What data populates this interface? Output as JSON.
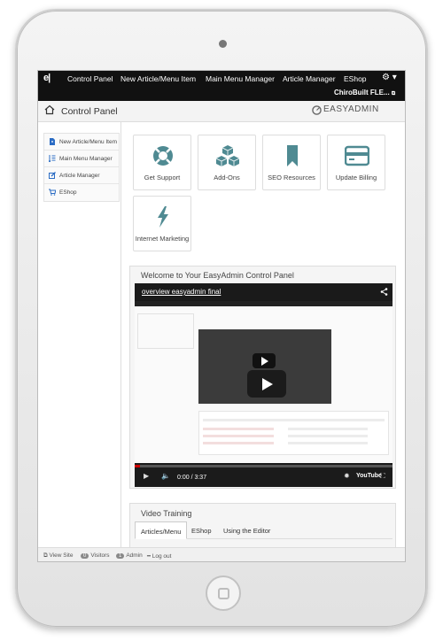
{
  "navbar": {
    "logo": "e|",
    "items": [
      "Control Panel",
      "New Article/Menu Item",
      "Main Menu Manager",
      "Article Manager",
      "EShop"
    ],
    "user": "ChiroBuilt FLE..."
  },
  "header": {
    "title": "Control Panel",
    "brand": "EASYADMIN"
  },
  "sidebar": {
    "items": [
      {
        "label": "New Article/Menu Item",
        "icon": "file-icon"
      },
      {
        "label": "Main Menu Manager",
        "icon": "list-icon"
      },
      {
        "label": "Article Manager",
        "icon": "edit-icon"
      },
      {
        "label": "EShop",
        "icon": "cart-icon"
      }
    ]
  },
  "tiles": [
    {
      "label": "Get Support",
      "icon": "lifebuoy-icon"
    },
    {
      "label": "Add-Ons",
      "icon": "cubes-icon"
    },
    {
      "label": "SEO Resources",
      "icon": "bookmark-icon"
    },
    {
      "label": "Update Billing",
      "icon": "credit-card-icon"
    },
    {
      "label": "Internet Marketing",
      "icon": "bolt-icon"
    }
  ],
  "welcome": {
    "title": "Welcome to Your EasyAdmin Control Panel",
    "video": {
      "title": "overview easyadmin final",
      "time": "0:00 / 3:37",
      "progress": 0.02,
      "provider": "YouTube"
    }
  },
  "training": {
    "title": "Video Training",
    "tabs": [
      "Articles/Menu",
      "EShop",
      "Using the Editor"
    ],
    "active_tab": "Articles/Menu"
  },
  "footer": {
    "view_site": "View Site",
    "visitors_count": "0",
    "visitors_label": "Visitors",
    "admin_count": "1",
    "admin_label": "Admin",
    "logout": "Log out"
  },
  "colors": {
    "navbar": "#111111",
    "icon_accent": "#4f8a92",
    "sidebar_icon": "#2b6cc4"
  }
}
